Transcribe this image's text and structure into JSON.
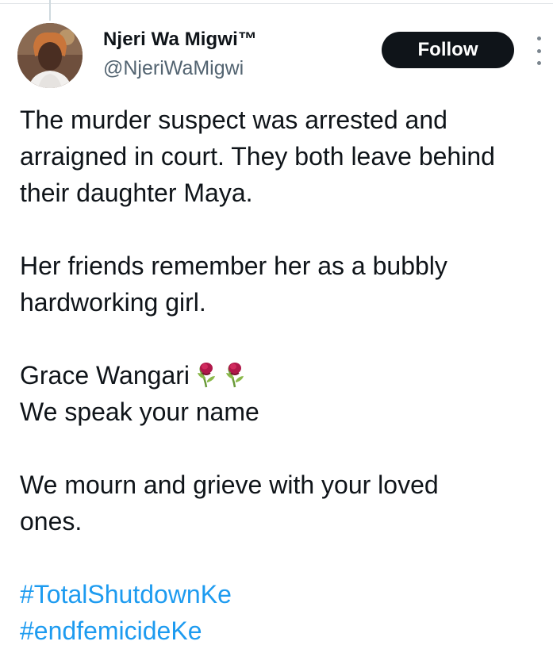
{
  "author": {
    "display_name": "Njeri Wa Migwi™",
    "handle": "@NjeriWaMigwi"
  },
  "actions": {
    "follow_label": "Follow"
  },
  "tweet": {
    "paragraph1": [
      "The murder suspect was arrested and",
      "arraigned in court. They both leave behind",
      "their daughter Maya."
    ],
    "paragraph2": [
      "Her friends remember her as a bubbly",
      "hardworking girl."
    ],
    "paragraph3": {
      "line1": "Grace Wangari",
      "emoji": [
        "wilted-flower-icon",
        "wilted-flower-icon"
      ],
      "line2": "We speak your name"
    },
    "paragraph4": [
      "We mourn and grieve with your loved",
      "ones."
    ],
    "hashtags": [
      "#TotalShutdownKe",
      "#endfemicideKe"
    ]
  },
  "colors": {
    "link": "#1d9bf0",
    "text": "#0f1419",
    "secondary_text": "#536471",
    "button_bg": "#0f1419"
  }
}
